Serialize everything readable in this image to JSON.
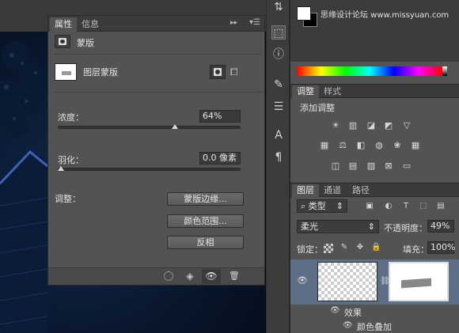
{
  "watermark": "思缘设计论坛 www.missyuan.com",
  "properties_panel": {
    "tabs": [
      "属性",
      "信息"
    ],
    "mask_type_label": "蒙版",
    "layer_mask_label": "图层蒙版",
    "density": {
      "label": "浓度：",
      "value": "64%",
      "level_percent": 64
    },
    "feather": {
      "label": "羽化：",
      "value": "0.0 像素",
      "level_percent": 0
    },
    "adjust_label": "调整：",
    "buttons": {
      "mask_edge": "蒙版边缘...",
      "color_range": "颜色范围...",
      "invert": "反相"
    }
  },
  "adjustments_panel": {
    "tabs": [
      "调整",
      "样式"
    ],
    "title": "添加调整"
  },
  "layers_panel": {
    "tabs": [
      "图层",
      "通道",
      "路径"
    ],
    "filter_kind": "类型",
    "blend_mode": "柔光",
    "opacity_label": "不透明度：",
    "opacity_value": "49%",
    "lock_label": "锁定：",
    "fill_label": "填充：",
    "fill_value": "100%",
    "effects_label": "效果",
    "effect_item": "颜色叠加"
  },
  "colors": {
    "foreground": "#ffffff",
    "background": "#000000",
    "panel_bg": "#535353",
    "selected_layer": "#5d6e86"
  },
  "icons": [
    "transform-icon",
    "3d-icon",
    "info-icon",
    "brush-icon",
    "adjust-icon",
    "type-icon",
    "paragraph-icon"
  ]
}
